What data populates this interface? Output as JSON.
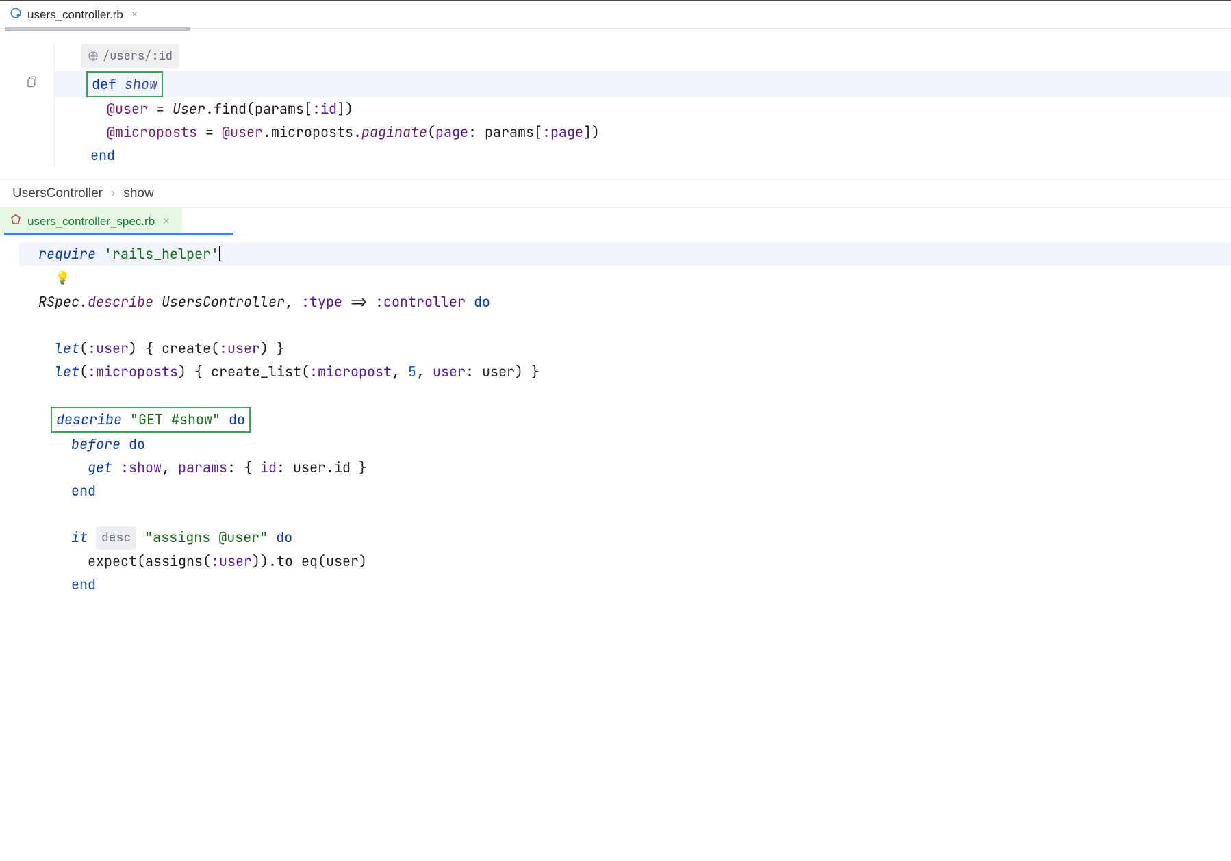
{
  "top_pane": {
    "tab": {
      "filename": "users_controller.rb"
    },
    "route_hint": "/users/:id",
    "code": {
      "def": "def",
      "show": "show",
      "l2": "    @user = User.find(params[:id])",
      "l3": "    @microposts = @user.microposts.paginate(page: params[:page])",
      "end": "  end"
    },
    "breadcrumb": {
      "controller": "UsersController",
      "action": "show"
    }
  },
  "bottom_pane": {
    "tab": {
      "filename": "users_controller_spec.rb"
    },
    "code": {
      "require": "require",
      "helper_str": "'rails_helper'",
      "rs_line_pre": "RSpec",
      "rs_desc": ".describe ",
      "rs_cls": "UsersController",
      "rs_mid": ", ",
      "rs_type_sym": ":type",
      "rs_arrow": " => ",
      "rs_ctrl_sym": ":controller",
      "rs_do": " do",
      "let_user": "  let(:user) { create(:user) }",
      "let_mp_pre": "  let(:microposts) { create_list(:micropost, ",
      "let_mp_num": "5",
      "let_mp_post": ", user: user) }",
      "describe": "describe",
      "describe_str": "\"GET #show\"",
      "do": "do",
      "before": "before",
      "get_line": "      get :show, params: { id: user.id }",
      "end": "    end",
      "it": "it",
      "desc_pill": "desc",
      "it_str": "\"assigns @user\"",
      "expect": "      expect(assigns(:user)).to eq(user)"
    }
  }
}
